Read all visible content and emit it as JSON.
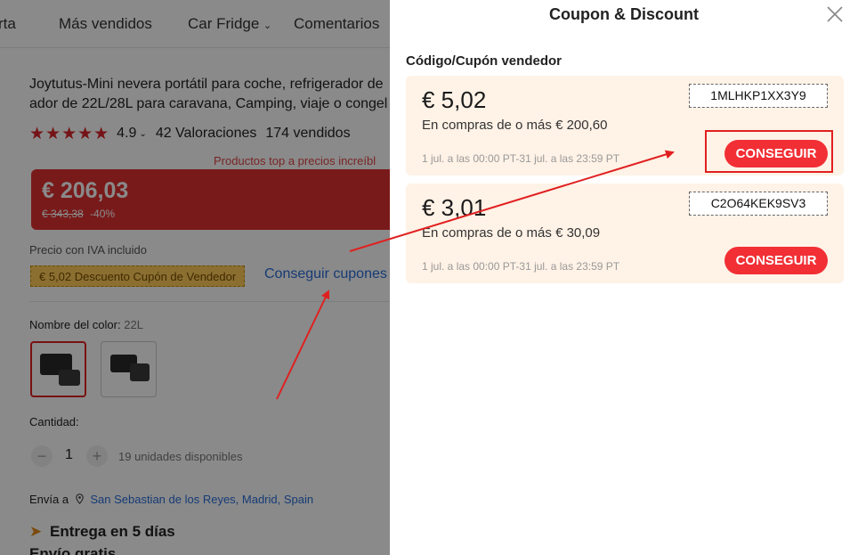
{
  "background": {
    "nav": [
      "rta",
      "Más vendidos",
      "Car Fridge",
      "Comentarios"
    ],
    "title": "Joytutus-Mini nevera portátil para coche, refrigerador de ador de 22L/28L para caravana, Camping, viaje o congel",
    "rating": {
      "stars": "★★★★★",
      "score": "4.9",
      "reviews": "42 Valoraciones",
      "sold": "174 vendidos"
    },
    "top_banner": "Productos top a precios increíbl",
    "price": {
      "current": "€ 206,03",
      "original": "€ 343,38",
      "discount": "-40%"
    },
    "iva": "Precio con IVA incluido",
    "coupon_tag": "€ 5,02 Descuento Cupón de Vendedor",
    "get_coupons": "Conseguir cupones",
    "color": {
      "label": "Nombre del color:",
      "value": "22L"
    },
    "quantity": {
      "label": "Cantidad:",
      "minus": "−",
      "plus": "+",
      "value": "1",
      "available": "19 unidades disponibles"
    },
    "ship": {
      "label": "Envía a",
      "location": "San Sebastian de los Reyes, Madrid, Spain"
    },
    "delivery": "Entrega en 5 días",
    "free_shipping": "Envío gratis"
  },
  "drawer": {
    "title": "Coupon & Discount",
    "section_title": "Código/Cupón vendedor",
    "coupons": [
      {
        "amount": "€ 5,02",
        "condition": "En compras de o más € 200,60",
        "dates": "1 jul. a las 00:00 PT-31 jul. a las 23:59 PT",
        "code": "1MLHKP1XX3Y9",
        "button": "CONSEGUIR"
      },
      {
        "amount": "€ 3,01",
        "condition": "En compras de o más € 30,09",
        "dates": "1 jul. a las 00:00 PT-31 jul. a las 23:59 PT",
        "code": "C2O64KEK9SV3",
        "button": "CONSEGUIR"
      }
    ]
  },
  "colors": {
    "accent_red": "#f12f35",
    "coupon_bg": "#fff2e6",
    "link_blue": "#2a6dd8",
    "annotation_red": "#e02020"
  }
}
